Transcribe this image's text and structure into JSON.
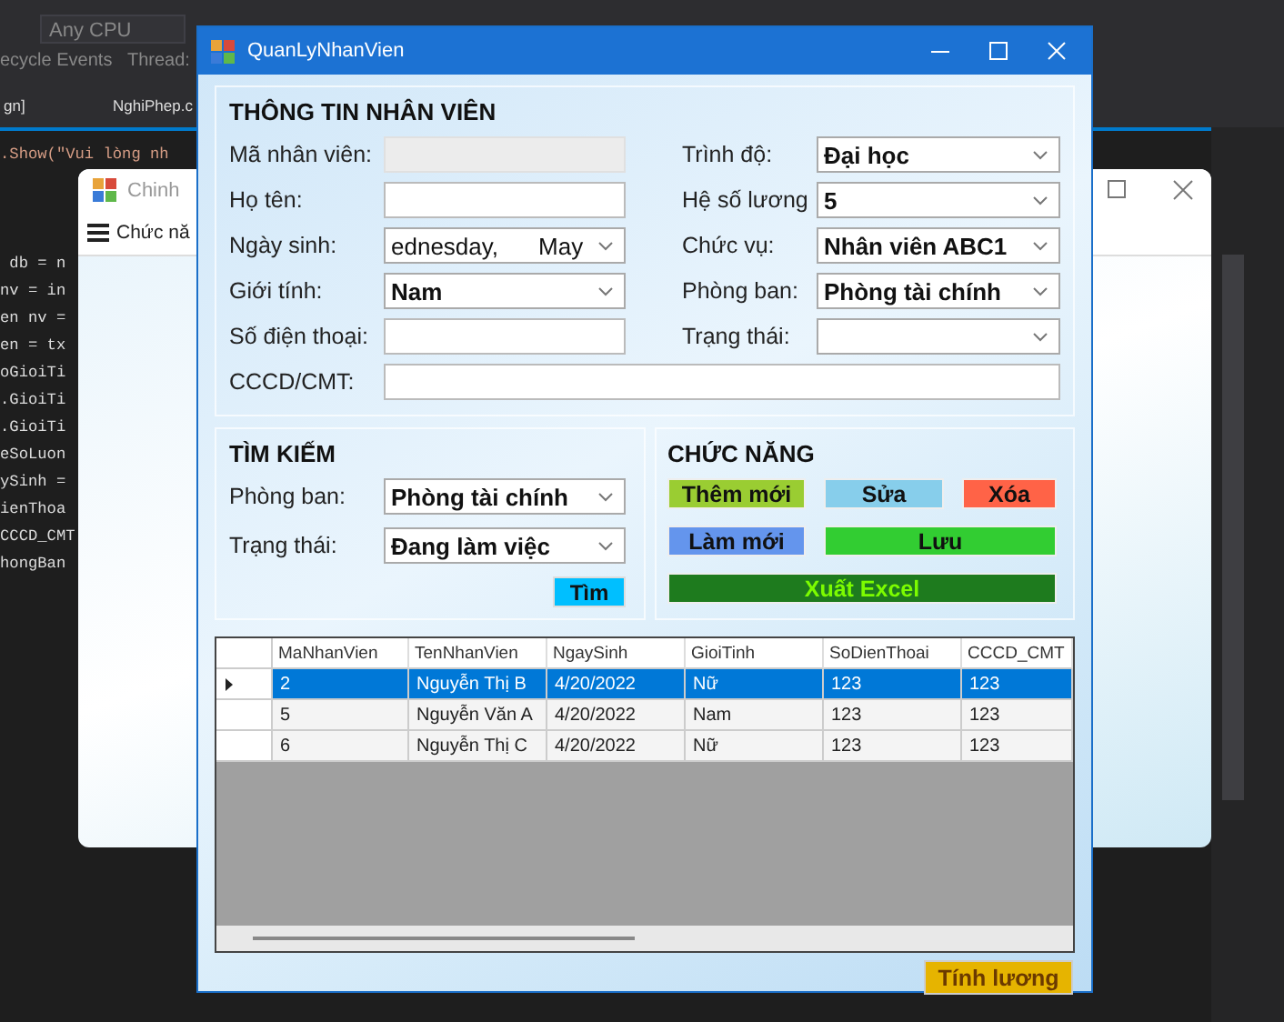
{
  "ide": {
    "config": "Any CPU",
    "events": "ecycle Events",
    "thread": "Thread:",
    "tabs": [
      "gn]",
      "NghiPhep.c"
    ],
    "show_line": ".Show(\"Vui lòng nh",
    "code_lines": [
      " db = n",
      "nv = in",
      "en nv =",
      "en = tx",
      "oGioiTi",
      ".GioiTi",
      ".GioiTi",
      "eSoLuon",
      "ySinh =",
      "ienThoa",
      "CCCD_CMT",
      "hongBan"
    ]
  },
  "back_window": {
    "title": "Chinh",
    "menu": "Chức nă"
  },
  "window": {
    "title": "QuanLyNhanVien"
  },
  "info": {
    "title": "THÔNG TIN NHÂN VIÊN",
    "left": [
      {
        "label": "Mã nhân viên:",
        "kind": "text",
        "disabled": true
      },
      {
        "label": "Họ tên:",
        "kind": "text",
        "disabled": false
      },
      {
        "label": "Ngày sinh:",
        "kind": "date",
        "parts": [
          "ednesday,",
          "May"
        ]
      },
      {
        "label": "Giới tính:",
        "kind": "combo",
        "value": "Nam"
      },
      {
        "label": "Số điện thoại:",
        "kind": "text",
        "disabled": false
      }
    ],
    "right": [
      {
        "label": "Trình độ:",
        "kind": "combo",
        "value": "Đại học"
      },
      {
        "label": "Hệ số lương",
        "kind": "combo",
        "value": "5"
      },
      {
        "label": "Chức vụ:",
        "kind": "combo",
        "value": "Nhân viên ABC1"
      },
      {
        "label": "Phòng ban:",
        "kind": "combo",
        "value": "Phòng tài chính"
      },
      {
        "label": "Trạng thái:",
        "kind": "combo"
      }
    ],
    "id_card": {
      "label": "CCCD/CMT:"
    }
  },
  "search": {
    "title": "TÌM KIẾM",
    "fields": [
      {
        "label": "Phòng ban:",
        "value": "Phòng tài chính"
      },
      {
        "label": "Trạng thái:",
        "value": "Đang làm việc"
      }
    ],
    "button": "Tìm"
  },
  "functions": {
    "title": "CHỨC NĂNG",
    "buttons": [
      {
        "label": "Thêm mới",
        "color": "#9acd32"
      },
      {
        "label": "Sửa",
        "color": "#87ceeb"
      },
      {
        "label": "Xóa",
        "color": "#ff6347"
      },
      {
        "label": "Làm mới",
        "color": "#6495ed"
      },
      {
        "label": "Lưu",
        "color": "#32cd32"
      },
      {
        "label": "Xuất Excel",
        "color": "#1e7b1e"
      }
    ]
  },
  "table": {
    "columns": [
      "MaNhanVien",
      "TenNhanVien",
      "NgaySinh",
      "GioiTinh",
      "SoDienThoai",
      "CCCD_CMT"
    ],
    "rows": [
      {
        "selected": true,
        "cells": [
          "2",
          "Nguyễn Thị B",
          "4/20/2022",
          "Nữ",
          "123",
          "123"
        ]
      },
      {
        "selected": false,
        "cells": [
          "5",
          "Nguyễn Văn A",
          "4/20/2022",
          "Nam",
          "123",
          "123"
        ]
      },
      {
        "selected": false,
        "cells": [
          "6",
          "Nguyễn Thị C",
          "4/20/2022",
          "Nữ",
          "123",
          "123"
        ]
      }
    ]
  },
  "salary_button": "Tính lương"
}
